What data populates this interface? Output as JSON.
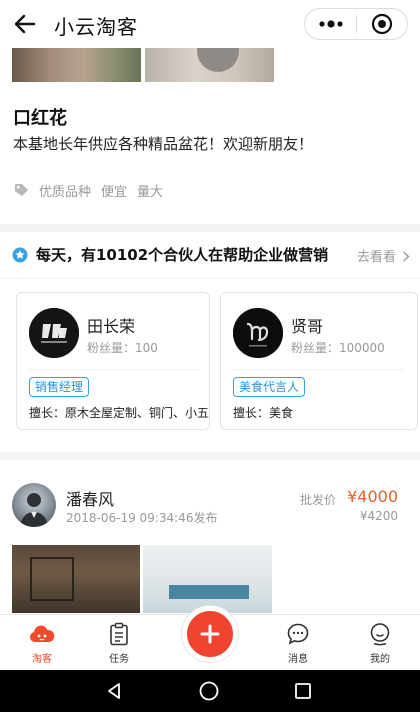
{
  "header": {
    "title": "小云淘客",
    "back_icon": "arrow-left-icon",
    "more_icon": "more-dots-icon",
    "close_icon": "target-close-icon"
  },
  "shop": {
    "name": "口红花",
    "description": "本基地长年供应各种精品盆花！欢迎新朋友！",
    "tags": [
      "优质品种",
      "便宜",
      "量大"
    ],
    "tag_icon": "tag-icon"
  },
  "partners": {
    "title": "每天，有10102个合伙人在帮助企业做营销",
    "more_label": "去看看",
    "cards": [
      {
        "name": "田长荣",
        "fans": "粉丝量：100",
        "badge": "销售经理",
        "skill": "擅长：原木全屋定制、铜门、小五"
      },
      {
        "name": "贤哥",
        "fans": "粉丝量：100000",
        "badge": "美食代言人",
        "skill": "擅长：美食"
      }
    ]
  },
  "post": {
    "name": "潘春风",
    "time": "2018-06-19 09:34:46发布",
    "price_label": "批发价",
    "price": "¥4000",
    "original_price": "¥4200"
  },
  "tabbar": {
    "items": [
      {
        "label": "淘客",
        "icon": "cloud-home-icon",
        "active": true
      },
      {
        "label": "任务",
        "icon": "clipboard-icon",
        "active": false
      },
      {
        "label": "消息",
        "icon": "chat-bubble-icon",
        "active": false
      },
      {
        "label": "我的",
        "icon": "user-smile-icon",
        "active": false
      }
    ],
    "center_icon": "plus-icon"
  },
  "colors": {
    "accent": "#f0442e",
    "price": "#e8602e",
    "badge": "#2b8fd6"
  }
}
